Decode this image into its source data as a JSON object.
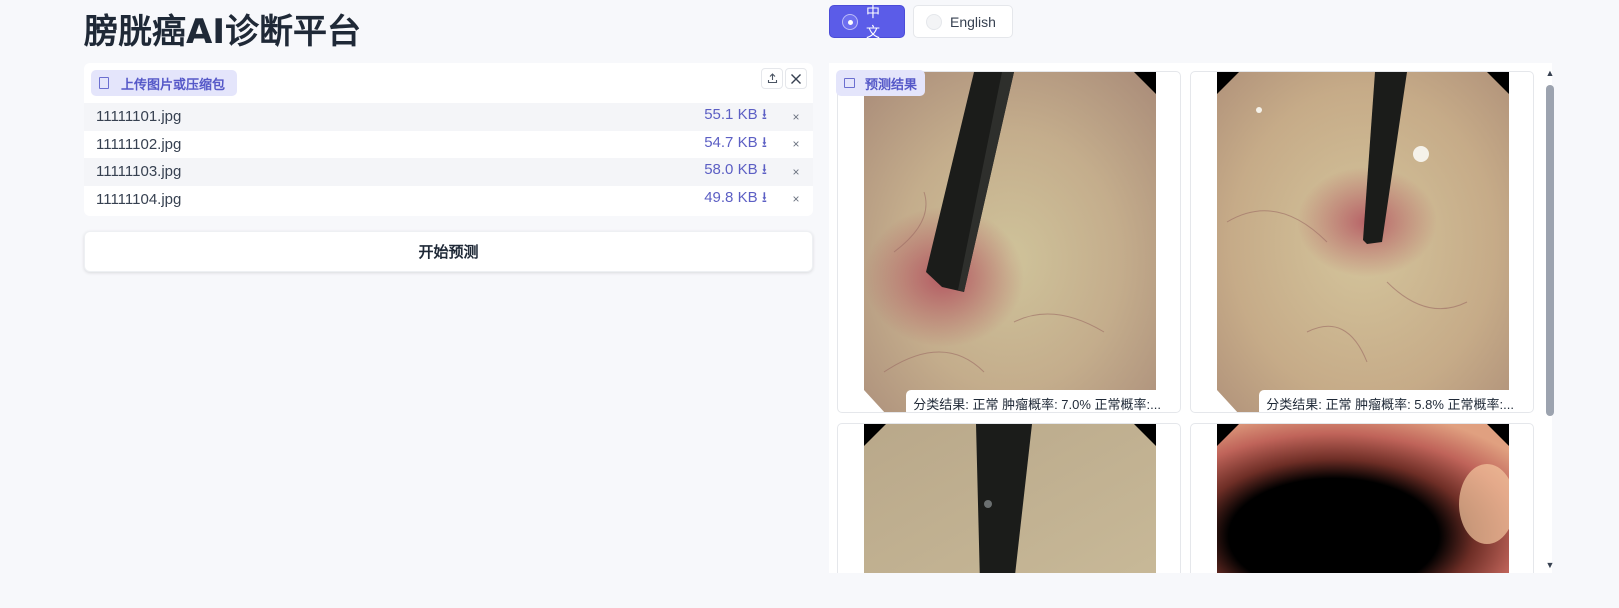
{
  "page_title": "膀胱癌AI诊断平台",
  "language": {
    "options": [
      {
        "label": "中文",
        "selected": true
      },
      {
        "label": "English",
        "selected": false
      }
    ]
  },
  "upload": {
    "label": "上传图片或压缩包",
    "files": [
      {
        "name": "11111101.jpg",
        "size": "55.1 KB ⭳"
      },
      {
        "name": "11111102.jpg",
        "size": "54.7 KB ⭳"
      },
      {
        "name": "11111103.jpg",
        "size": "58.0 KB ⭳"
      },
      {
        "name": "11111104.jpg",
        "size": "49.8 KB ⭳"
      }
    ],
    "delete_symbol": "×",
    "upload_icon": "upload-icon",
    "clear_icon": "close-icon"
  },
  "predict_button": "开始预测",
  "results": {
    "label": "预测结果",
    "captions": [
      "分类结果: 正常 肿瘤概率: 7.0% 正常概率:...",
      "分类结果: 正常 肿瘤概率: 5.8% 正常概率:..."
    ]
  },
  "colors": {
    "accent": "#5b5ce8",
    "label_bg": "#e4e5fb",
    "link": "#5c5fc4"
  }
}
